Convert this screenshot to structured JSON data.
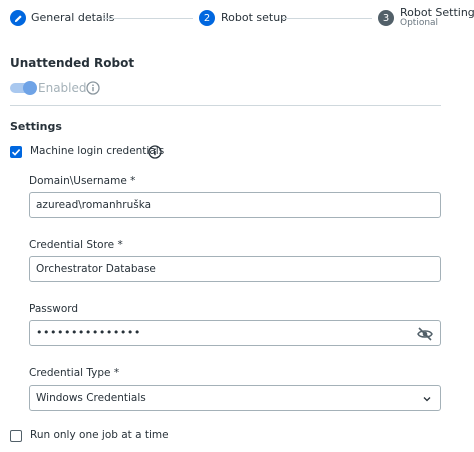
{
  "stepper": {
    "steps": [
      {
        "number": "",
        "label": "General details",
        "sublabel": "",
        "state": "done",
        "icon": "pencil-icon"
      },
      {
        "number": "2",
        "label": "Robot setup",
        "sublabel": "",
        "state": "active"
      },
      {
        "number": "3",
        "label": "Robot Settings",
        "sublabel": "Optional",
        "state": "future"
      }
    ]
  },
  "unattended": {
    "title": "Unattended Robot",
    "toggle_label": "Enabled",
    "toggle_on": true,
    "toggle_disabled": true
  },
  "settings": {
    "title": "Settings",
    "machine_login": {
      "label": "Machine login credentials",
      "checked": true
    },
    "fields": {
      "username": {
        "label": "Domain\\Username *",
        "value": "azuread\\romanhruška"
      },
      "credential_store": {
        "label": "Credential Store *",
        "value": "Orchestrator Database"
      },
      "password": {
        "label": "Password",
        "value": "•••••••••••••••"
      },
      "credential_type": {
        "label": "Credential Type *",
        "value": "Windows Credentials"
      }
    },
    "run_one_job": {
      "label": "Run only one job at a time",
      "checked": false
    }
  },
  "colors": {
    "accent": "#0067df",
    "border": "#a4b1b8",
    "text": "#273139"
  }
}
